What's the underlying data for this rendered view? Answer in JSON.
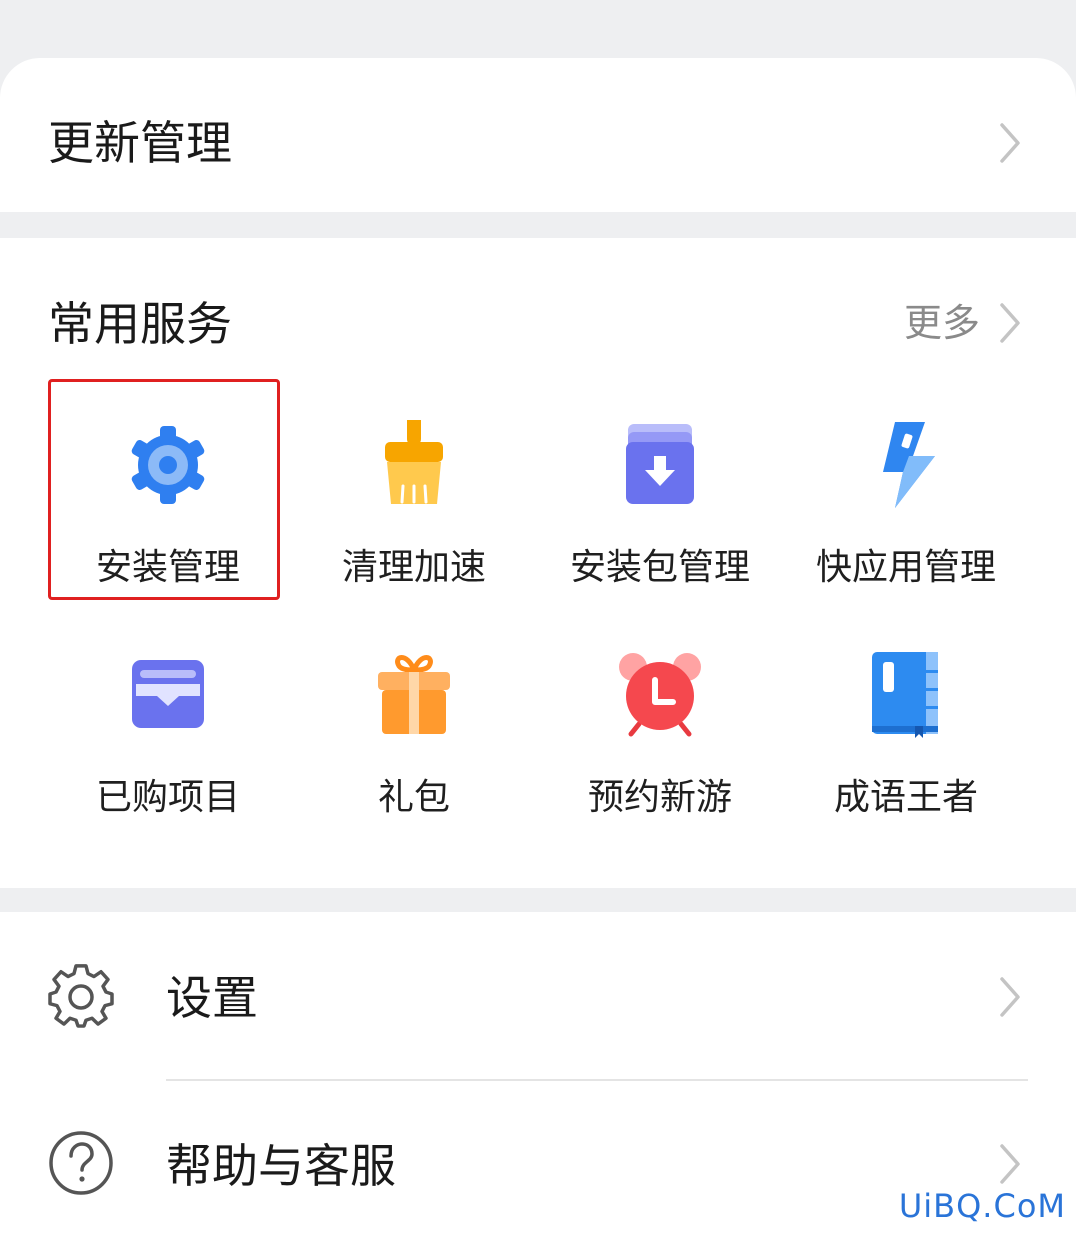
{
  "update_row": {
    "title": "更新管理"
  },
  "services": {
    "title": "常用服务",
    "more_label": "更多",
    "items": [
      {
        "label": "安装管理",
        "icon": "gear-icon"
      },
      {
        "label": "清理加速",
        "icon": "brush-icon"
      },
      {
        "label": "安装包管理",
        "icon": "package-download-icon"
      },
      {
        "label": "快应用管理",
        "icon": "lightning-icon"
      },
      {
        "label": "已购项目",
        "icon": "wallet-icon"
      },
      {
        "label": "礼包",
        "icon": "gift-icon"
      },
      {
        "label": "预约新游",
        "icon": "alarm-clock-icon"
      },
      {
        "label": "成语王者",
        "icon": "book-icon"
      }
    ]
  },
  "settings_row": {
    "title": "设置",
    "icon": "settings-gear-icon"
  },
  "help_row": {
    "title": "帮助与客服",
    "icon": "question-icon"
  },
  "watermark": "UiBQ.CoM",
  "colors": {
    "highlight_border": "#e02020",
    "blue_icon": "#2f7ff0",
    "orange_icon": "#ff9a2e",
    "red_icon": "#f5484e",
    "purple_icon": "#6a72ee",
    "watermark": "#2a74d8"
  }
}
